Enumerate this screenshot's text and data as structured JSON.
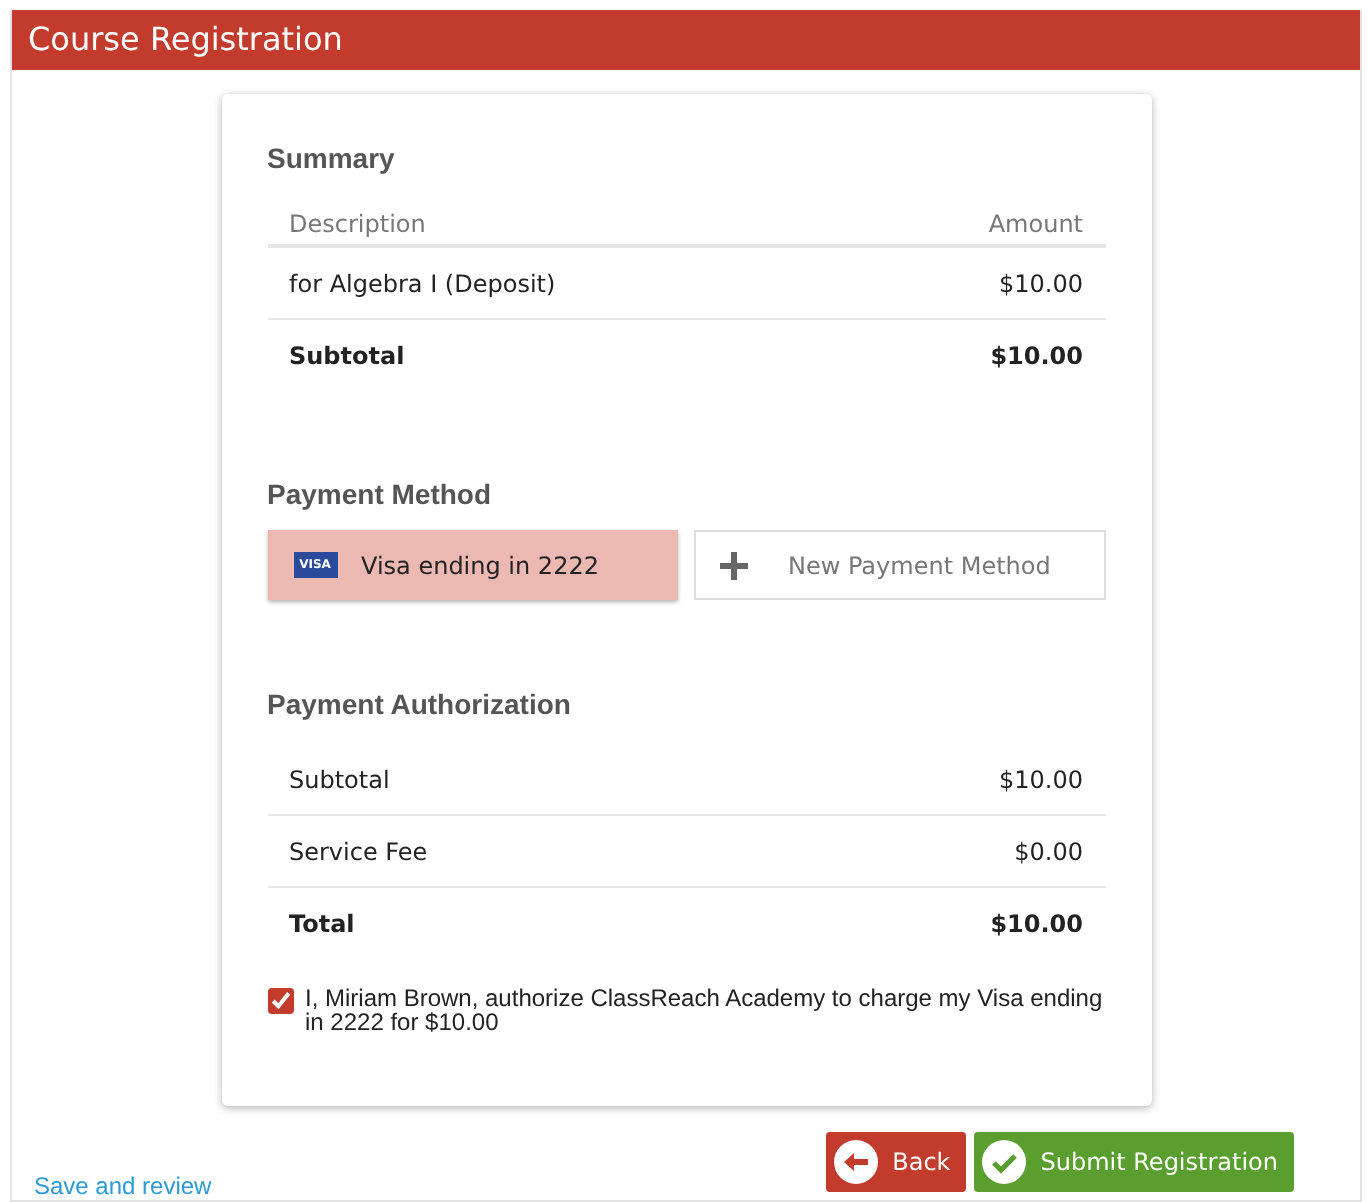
{
  "header": {
    "title": "Course Registration"
  },
  "summary": {
    "title": "Summary",
    "columns": [
      "Description",
      "Amount"
    ],
    "rows": [
      {
        "description": "for Algebra I (Deposit)",
        "amount": "$10.00",
        "kind": "item"
      },
      {
        "description": "Subtotal",
        "amount": "$10.00",
        "kind": "total"
      }
    ]
  },
  "payment_method": {
    "title": "Payment Method",
    "options": [
      {
        "kind": "card",
        "label": "Visa ending in 2222",
        "card_brand": "VISA",
        "selected": true
      },
      {
        "kind": "new",
        "label": "New Payment Method",
        "selected": false
      }
    ]
  },
  "payment_authorization": {
    "title": "Payment Authorization",
    "rows": [
      {
        "label": "Subtotal",
        "amount": "$10.00",
        "kind": "item"
      },
      {
        "label": "Service Fee",
        "amount": "$0.00",
        "kind": "item"
      },
      {
        "label": "Total",
        "amount": "$10.00",
        "kind": "total"
      }
    ],
    "consent": {
      "checked": true,
      "text": "I, Miriam Brown, authorize ClassReach Academy to charge my Visa ending in 2222 for $10.00"
    }
  },
  "footer": {
    "link": "Save and review",
    "buttons": [
      {
        "kind": "back",
        "label": "Back"
      },
      {
        "kind": "submit",
        "label": "Submit Registration"
      }
    ]
  }
}
